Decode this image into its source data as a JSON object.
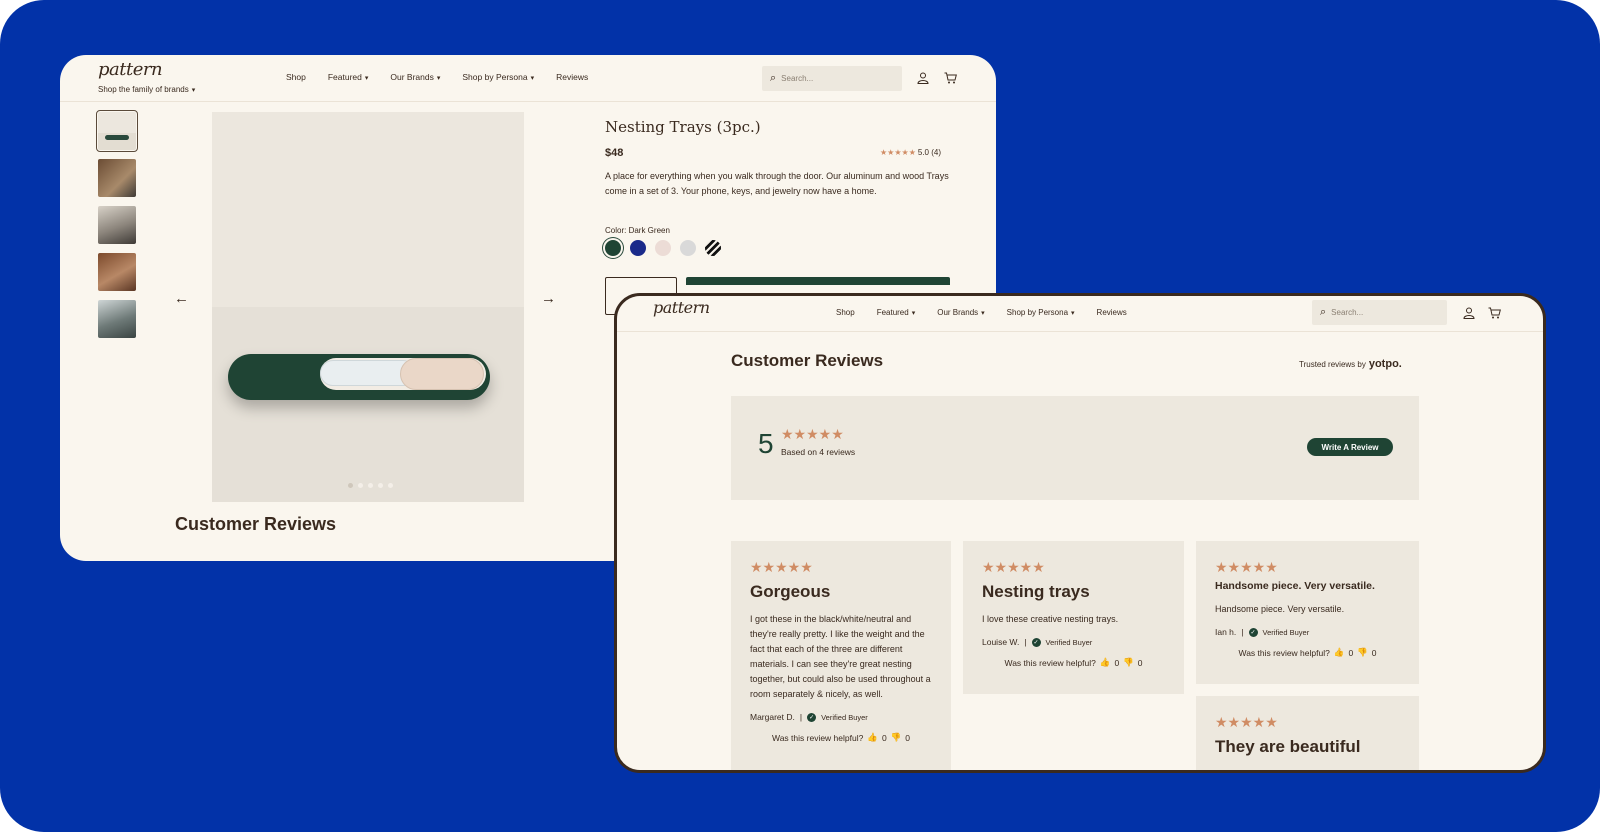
{
  "window1": {
    "logo": "pattern",
    "family_label": "Shop the family of brands",
    "nav": {
      "shop": "Shop",
      "featured": "Featured",
      "brands": "Our Brands",
      "persona": "Shop by Persona",
      "reviews": "Reviews"
    },
    "search_placeholder": "Search...",
    "product": {
      "title": "Nesting Trays (3pc.)",
      "price": "$48",
      "stars": "★★★★★",
      "rating": "5.0 (4)",
      "description": "A place for everything when you walk through the door. Our aluminum and wood Trays come in a set of 3. Your phone, keys, and jewelry now have a home.",
      "color_label": "Color: Dark Green"
    },
    "reviews_heading": "Customer Reviews"
  },
  "window2": {
    "logo": "pattern",
    "nav": {
      "shop": "Shop",
      "featured": "Featured",
      "brands": "Our Brands",
      "persona": "Shop by Persona",
      "reviews": "Reviews"
    },
    "search_placeholder": "Search...",
    "title": "Customer Reviews",
    "trusted_prefix": "Trusted reviews by",
    "trusted_brand": "yotpo.",
    "summary": {
      "score": "5",
      "stars": "★★★★★",
      "based_on": "Based on 4 reviews",
      "write_button": "Write A Review"
    },
    "reviews": [
      {
        "stars": "★★★★★",
        "title": "Gorgeous",
        "body": "I got these in the black/white/neutral and they're really pretty. I like the weight and the fact that each of the three are different materials. I can see they're great nesting together, but could also be used throughout a room separately & nicely, as well.",
        "author": "Margaret D.",
        "verified": "Verified Buyer",
        "helpful": "Was this review helpful?",
        "up": "0",
        "down": "0"
      },
      {
        "stars": "★★★★★",
        "title": "Nesting trays",
        "body": "I love these creative nesting trays.",
        "author": "Louise W.",
        "verified": "Verified Buyer",
        "helpful": "Was this review helpful?",
        "up": "0",
        "down": "0"
      },
      {
        "stars": "★★★★★",
        "title": "Handsome piece. Very versatile.",
        "body": "Handsome piece. Very versatile.",
        "author": "Ian h.",
        "verified": "Verified Buyer",
        "helpful": "Was this review helpful?",
        "up": "0",
        "down": "0"
      },
      {
        "stars": "★★★★★",
        "title": "They are beautiful"
      }
    ]
  },
  "colors": {
    "background": "#0232a8",
    "page": "#faf6ee",
    "accent": "#1f4434",
    "star": "#d08c64"
  },
  "icons": [
    "search-icon",
    "user-icon",
    "cart-icon",
    "chevron-down-icon",
    "arrow-left-icon",
    "arrow-right-icon",
    "check-icon",
    "thumbs-up-icon",
    "thumbs-down-icon"
  ]
}
